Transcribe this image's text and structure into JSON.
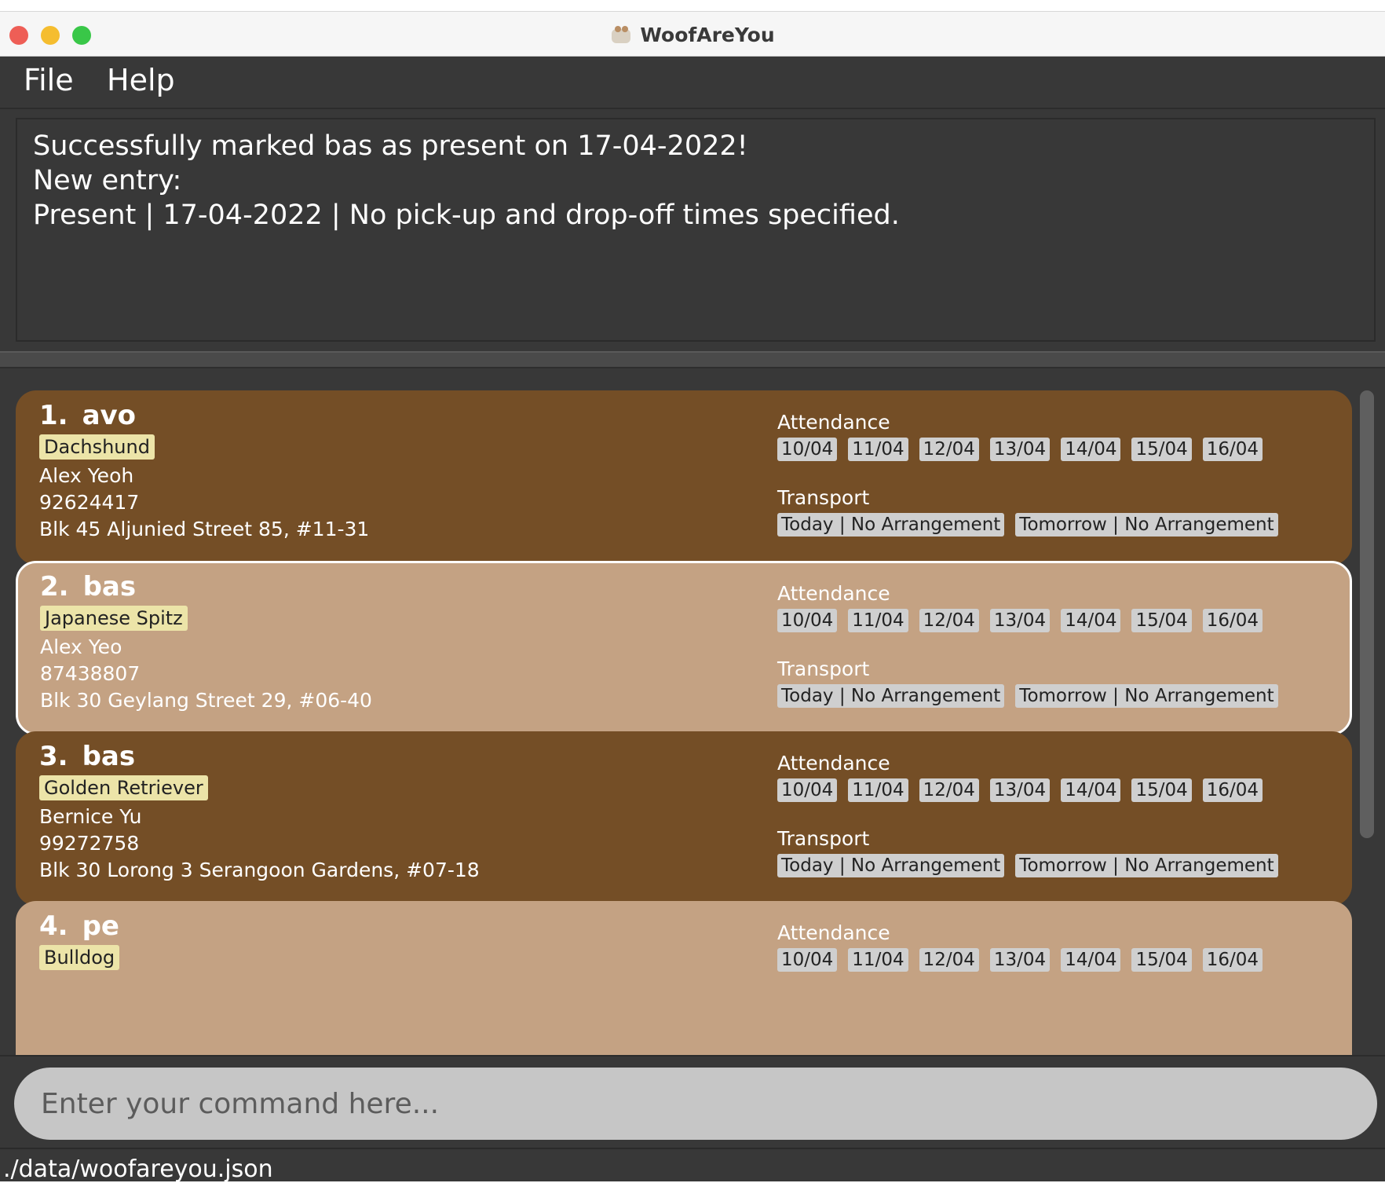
{
  "window": {
    "title": "WoofAreYou"
  },
  "menu": {
    "items": [
      "File",
      "Help"
    ]
  },
  "result": {
    "lines": [
      "Successfully marked bas as present on 17-04-2022!",
      "New entry:",
      "Present | 17-04-2022 | No pick-up and drop-off times specified."
    ]
  },
  "list": {
    "attendance_label": "Attendance",
    "transport_label": "Transport",
    "cards": [
      {
        "index": "1.",
        "name": "avo",
        "breed": "Dachshund",
        "owner": "Alex Yeoh",
        "phone": "92624417",
        "address": "Blk 45 Aljunied Street 85, #11-31",
        "attendance": [
          "10/04",
          "11/04",
          "12/04",
          "13/04",
          "14/04",
          "15/04",
          "16/04"
        ],
        "transport": [
          "Today | No Arrangement",
          "Tomorrow | No Arrangement"
        ],
        "style": "dark",
        "selected": false
      },
      {
        "index": "2.",
        "name": "bas",
        "breed": "Japanese Spitz",
        "owner": "Alex Yeo",
        "phone": "87438807",
        "address": "Blk 30 Geylang Street 29, #06-40",
        "attendance": [
          "10/04",
          "11/04",
          "12/04",
          "13/04",
          "14/04",
          "15/04",
          "16/04"
        ],
        "transport": [
          "Today | No Arrangement",
          "Tomorrow | No Arrangement"
        ],
        "style": "light",
        "selected": true
      },
      {
        "index": "3.",
        "name": "bas",
        "breed": "Golden Retriever",
        "owner": "Bernice Yu",
        "phone": "99272758",
        "address": "Blk 30 Lorong 3 Serangoon Gardens, #07-18",
        "attendance": [
          "10/04",
          "11/04",
          "12/04",
          "13/04",
          "14/04",
          "15/04",
          "16/04"
        ],
        "transport": [
          "Today | No Arrangement",
          "Tomorrow | No Arrangement"
        ],
        "style": "dark",
        "selected": false
      },
      {
        "index": "4.",
        "name": "pe",
        "breed": "Bulldog",
        "attendance": [
          "10/04",
          "11/04",
          "12/04",
          "13/04",
          "14/04",
          "15/04",
          "16/04"
        ],
        "style": "light",
        "selected": false
      }
    ]
  },
  "command": {
    "placeholder": "Enter your command here...",
    "value": ""
  },
  "status": {
    "path": "./data/woofareyou.json"
  },
  "colors": {
    "background": "#383838",
    "card_dark": "#744e26",
    "card_light": "#c4a283",
    "breed_tag": "#ece4a8",
    "chip": "#cfcfcf"
  }
}
